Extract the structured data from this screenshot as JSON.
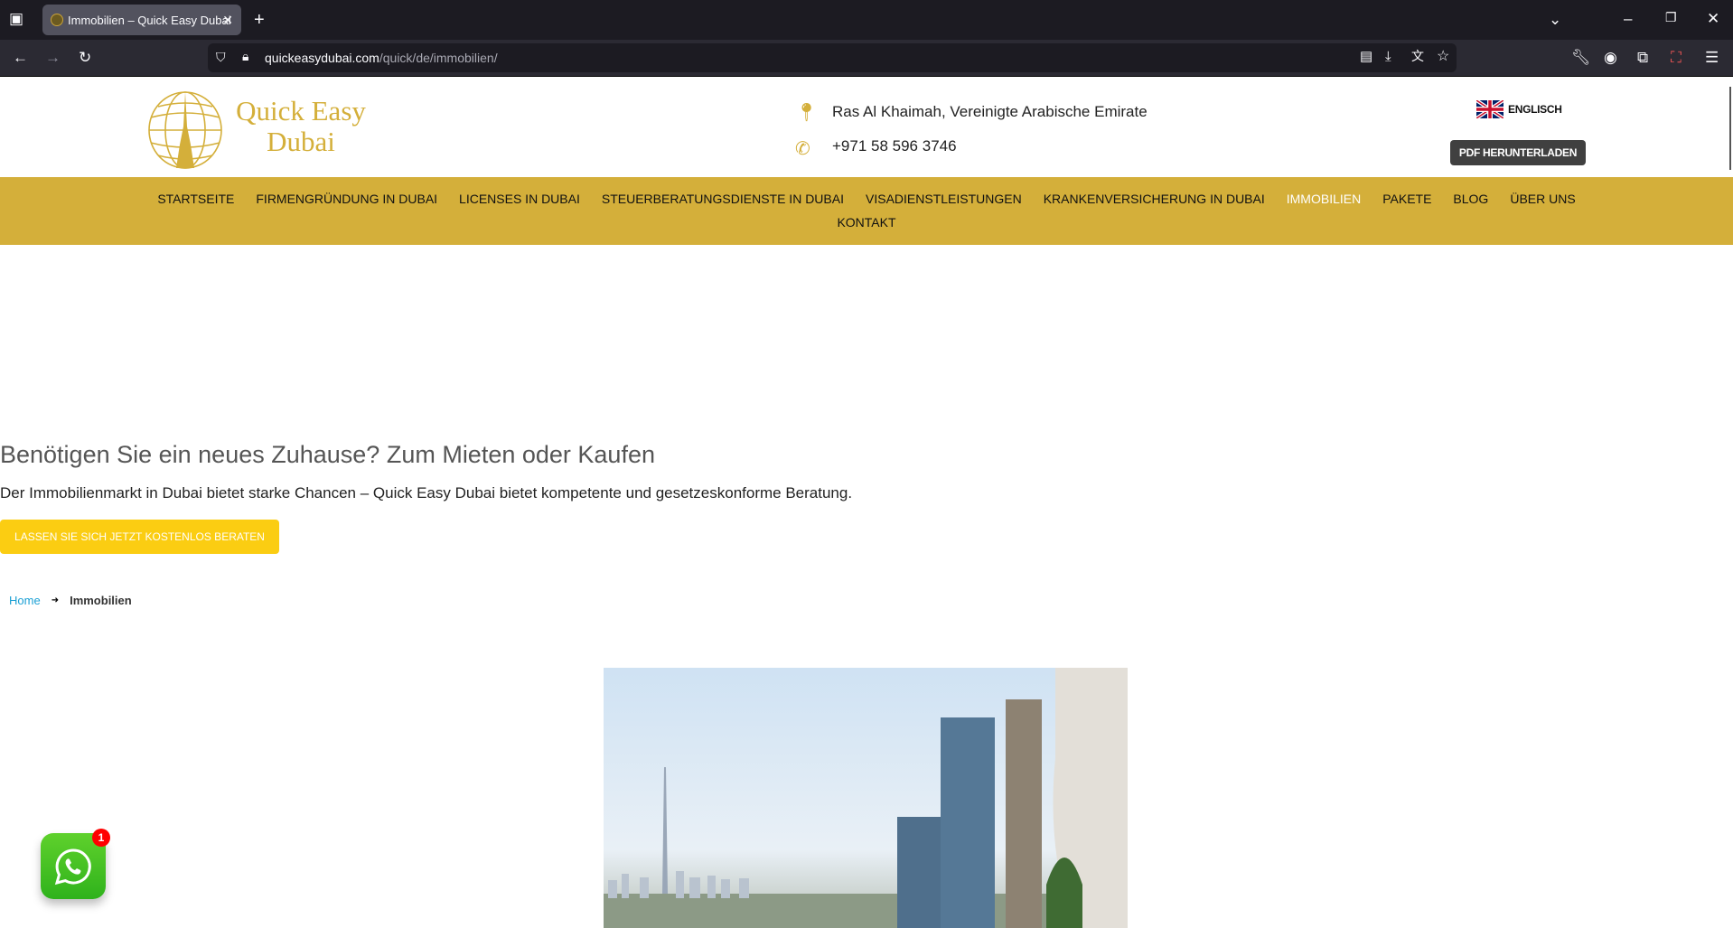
{
  "browser": {
    "tab_title": "Immobilien – Quick Easy Dubai",
    "url_domain": "quickeasydubai.com",
    "url_path": "/quick/de/immobilien/"
  },
  "header": {
    "logo_line1": "Quick Easy",
    "logo_line2": "Dubai",
    "address": "Ras Al Khaimah, Vereinigte Arabische Emirate",
    "phone": "+971 58 596 3746",
    "language": "ENGLISCH",
    "pdf_button": "PDF HERUNTERLADEN"
  },
  "nav": {
    "items": [
      "STARTSEITE",
      "FIRMENGRÜNDUNG IN DUBAI",
      "LICENSES IN DUBAI",
      "STEUERBERATUNGSDIENSTE IN DUBAI",
      "VISADIENSTLEISTUNGEN",
      "KRANKENVERSICHERUNG IN DUBAI",
      "IMMOBILIEN",
      "PAKETE",
      "BLOG",
      "ÜBER UNS"
    ],
    "row2": "KONTAKT",
    "active": "IMMOBILIEN"
  },
  "hero": {
    "heading": "Benötigen Sie ein neues Zuhause? Zum Mieten oder Kaufen",
    "lead": "Der Immobilienmarkt in Dubai bietet starke Chancen – Quick Easy Dubai bietet kompetente und gesetzeskonforme Beratung.",
    "cta": "LASSEN SIE SICH JETZT KOSTENLOS BERATEN"
  },
  "breadcrumb": {
    "home": "Home",
    "current": "Immobilien"
  },
  "whatsapp": {
    "badge": "1"
  },
  "colors": {
    "gold": "#d4af3a",
    "cta": "#fbcd12",
    "link": "#1a9fd4"
  }
}
